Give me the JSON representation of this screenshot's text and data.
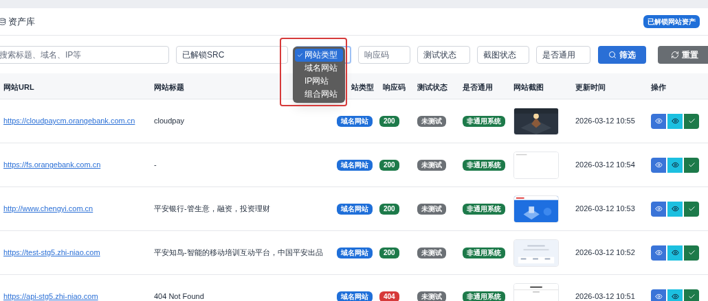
{
  "header": {
    "title": "资产库",
    "badge": "已解锁网站资产"
  },
  "filters": [
    {
      "kind": "input",
      "placeholder": "搜索标题、域名、IP等"
    },
    {
      "kind": "select",
      "value": "已解锁SRC"
    },
    {
      "kind": "dropdown",
      "options": [
        {
          "label": "网站类型",
          "selected": true
        },
        {
          "label": "域名网站",
          "selected": false
        },
        {
          "label": "IP网站",
          "selected": false
        },
        {
          "label": "组合网站",
          "selected": false
        }
      ]
    },
    {
      "kind": "input",
      "placeholder": "响应码"
    },
    {
      "kind": "select",
      "value": "测试状态"
    },
    {
      "kind": "select",
      "value": "截图状态"
    },
    {
      "kind": "select",
      "value": "是否通用"
    }
  ],
  "buttons": [
    {
      "kind": "primary",
      "label": "筛选"
    },
    {
      "kind": "secondary",
      "label": "重置"
    }
  ],
  "table": {
    "columns": [
      "网站URL",
      "网站标题",
      "站类型",
      "响应码",
      "测试状态",
      "是否通用",
      "网站截图",
      "更新时间",
      "操作"
    ],
    "rows": [
      {
        "url": "https://cloudpaycm.orangebank.com.cn",
        "title": "cloudpay",
        "type": "域名网站",
        "code": "200",
        "code_ok": true,
        "test": "未测试",
        "universal": "非通用系统",
        "time": "2026-03-12 10:55"
      },
      {
        "url": "https://fs.orangebank.com.cn",
        "title": "-",
        "type": "域名网站",
        "code": "200",
        "code_ok": true,
        "test": "未测试",
        "universal": "非通用系统",
        "time": "2026-03-12 10:54"
      },
      {
        "url": "http://www.chengyi.com.cn",
        "title": "平安银行-管生意，融资，投资理财",
        "type": "域名网站",
        "code": "200",
        "code_ok": true,
        "test": "未测试",
        "universal": "非通用系统",
        "time": "2026-03-12 10:53"
      },
      {
        "url": "https://test-stg5.zhi-niao.com",
        "title": "平安知鸟-智能的移动培训互动平台，中国平安出品",
        "type": "域名网站",
        "code": "200",
        "code_ok": true,
        "test": "未测试",
        "universal": "非通用系统",
        "time": "2026-03-12 10:52"
      },
      {
        "url": "https://api-stg5.zhi-niao.com",
        "title": "404 Not Found",
        "type": "域名网站",
        "code": "404",
        "code_ok": false,
        "test": "未测试",
        "universal": "非通用系统",
        "time": "2026-03-12 10:51"
      }
    ]
  }
}
